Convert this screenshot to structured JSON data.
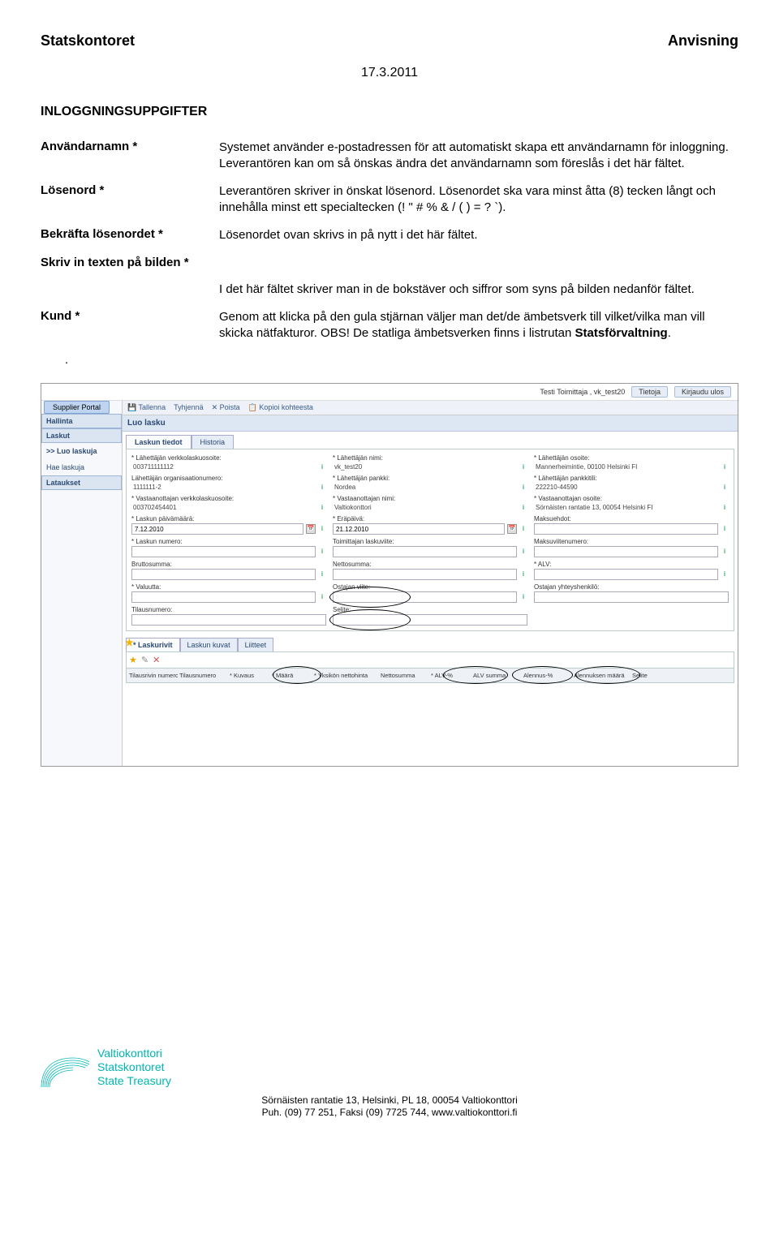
{
  "header": {
    "left": "Statskontoret",
    "right": "Anvisning",
    "date": "17.3.2011"
  },
  "section_title": "INLOGGNINGSUPPGIFTER",
  "rows": {
    "r1_label": "Användarnamn *",
    "r1_text": "Systemet använder e-postadressen för att automatiskt skapa ett användarnamn för inloggning. Leverantören kan om så önskas ändra det användarnamn som föreslås i det här fältet.",
    "r2_label": "Lösenord *",
    "r2_text": "Leverantören skriver in önskat lösenord. Lösenordet ska vara minst åtta (8) tecken långt och innehålla minst ett specialtecken (! \" # % & / ( ) = ? `).",
    "r3_label": "Bekräfta lösenordet *",
    "r3_text": "Lösenordet ovan skrivs in på nytt i det här fältet.",
    "r4_label": "Skriv in texten på bilden *",
    "r4_text": "I det här fältet skriver man in de bokstäver och siffror som syns på bilden nedanför fältet.",
    "r5_label": "Kund *",
    "r5_pre": "Genom att klicka på den gula stjärnan väljer man det/de ämbetsverk till vilket/vilka man vill skicka nätfakturor. OBS! De statliga ämbetsverken finns i listrutan ",
    "r5_bold": "Statsförvaltning",
    "r5_post": "."
  },
  "screenshot": {
    "top_user": "Testi Toimittaja , vk_test20",
    "top_b1": "Tietoja",
    "top_b2": "Kirjaudu ulos",
    "side_portal": "Supplier Portal",
    "side_sec1": "Hallinta",
    "side_sec2": "Laskut",
    "side_item1": ">> Luo laskuja",
    "side_item2": "Hae laskuja",
    "side_sec3": "Lataukset",
    "toolbar": {
      "save": "Tallenna",
      "reset": "Tyhjennä",
      "delete": "Poista",
      "copy": "Kopioi kohteesta"
    },
    "main_title": "Luo lasku",
    "tab1": "Laskun tiedot",
    "tab2": "Historia",
    "fields": {
      "f1l": "* Lähettäjän verkkolaskuosoite:",
      "f1v": "003711111112",
      "f2l": "* Lähettäjän nimi:",
      "f2v": "vk_test20",
      "f3l": "* Lähettäjän osoite:",
      "f3v": "Mannerheimintie, 00100 Helsinki FI",
      "f4l": "Lähettäjän organisaationumero:",
      "f4v": "1111111-2",
      "f5l": "* Lähettäjän pankki:",
      "f5v": "Nordea",
      "f6l": "* Lähettäjän pankkitili:",
      "f6v": "222210-44590",
      "f7l": "* Vastaanottajan verkkolaskuosoite:",
      "f7v": "003702454401",
      "f8l": "* Vastaanottajan nimi:",
      "f8v": "Valtiokonttori",
      "f9l": "* Vastaanottajan osoite:",
      "f9v": "Sörnäisten rantatie 13, 00054 Helsinki FI",
      "f10l": "* Laskun päivämäärä:",
      "f10v": "7.12.2010",
      "f11l": "* Eräpäivä:",
      "f11v": "21.12.2010",
      "f12l": "Maksuehdot:",
      "f12v": "",
      "f13l": "* Laskun numero:",
      "f13v": "",
      "f14l": "Toimittajan laskuviite:",
      "f14v": "",
      "f15l": "Maksuviitenumero:",
      "f15v": "",
      "f16l": "Bruttosumma:",
      "f16v": "",
      "f17l": "Nettosumma:",
      "f17v": "",
      "f18l": "* ALV:",
      "f18v": "",
      "f19l": "* Valuutta:",
      "f19v": "",
      "f20l": "Ostajan viite:",
      "f20v": "",
      "f21l": "Ostajan yhteyshenkilö:",
      "f21v": "",
      "f22l": "Tilausnumero:",
      "f22v": "",
      "f23l": "Selite:",
      "f23v": ""
    },
    "subtab1": "* Laskurivit",
    "subtab2": "Laskun kuvat",
    "subtab3": "Liitteet",
    "line_headers": {
      "c1": "Tilausrivin numero",
      "c2": "Tilausnumero",
      "c3": "* Kuvaus",
      "c4": "* Määrä",
      "c5": "* Yksikön nettohinta",
      "c6": "Nettosumma",
      "c7": "* ALV-%",
      "c8": "ALV summa",
      "c9": "Alennus-%",
      "c10": "Alennuksen määrä",
      "c11": "Selite"
    }
  },
  "footer": {
    "logo_l1": "Valtiokonttori",
    "logo_l2": "Statskontoret",
    "logo_l3": "State Treasury",
    "addr1": "Sörnäisten rantatie 13, Helsinki, PL 18, 00054 Valtiokonttori",
    "addr2": "Puh. (09) 77 251, Faksi (09) 7725 744, www.valtiokonttori.fi"
  }
}
